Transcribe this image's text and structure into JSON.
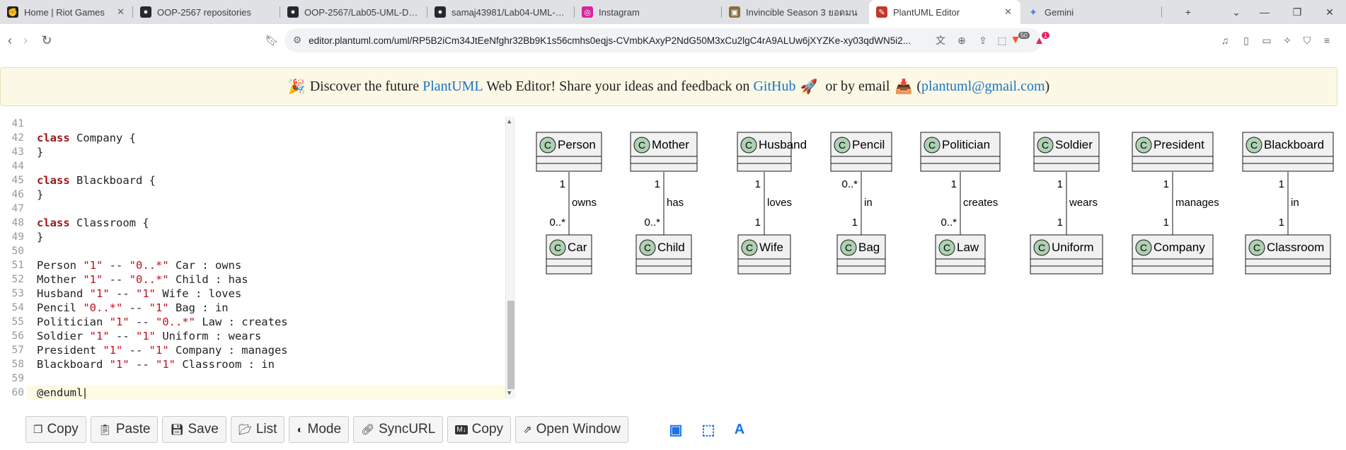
{
  "tabs": [
    {
      "title": "Home | Riot Games",
      "icon": "riot-icon",
      "close": "✕"
    },
    {
      "title": "OOP-2567 repositories",
      "icon": "github-icon"
    },
    {
      "title": "OOP-2567/Lab05-UML-Diagra",
      "icon": "github-icon"
    },
    {
      "title": "samaj43981/Lab04-UML-Diag",
      "icon": "github-icon"
    },
    {
      "title": "Instagram",
      "icon": "instagram-icon"
    },
    {
      "title": "Invincible Season 3 ยอดมน",
      "icon": "image-icon"
    },
    {
      "title": "PlantUML Editor",
      "icon": "plantuml-icon",
      "close": "✕"
    },
    {
      "title": "Gemini",
      "icon": "gemini-icon"
    }
  ],
  "new_tab": "+",
  "address": {
    "url": "editor.plantuml.com/uml/RP5B2iCm34JtEeNfghr32Bb9K1s56cmhs0eqjs-CVmbKAxyP2NdG50M3xCu2lgC4rA9ALUw6jXYZKe-xy03qdWN5i2...",
    "badge_brave": "50",
    "badge_alert": "1"
  },
  "banner": {
    "prefix": "Discover the future ",
    "link1": "PlantUML",
    "mid": " Web Editor! Share your ideas and feedback on ",
    "link2": "GitHub",
    "mid2": " or by email ",
    "open_paren": "(",
    "email": "plantuml@gmail.com",
    "close_paren": ")"
  },
  "editor": {
    "lines": [
      {
        "n": "41",
        "tokens": []
      },
      {
        "n": "42",
        "tokens": [
          {
            "t": "class",
            "c": "kw"
          },
          {
            "t": " Company {",
            "c": ""
          }
        ]
      },
      {
        "n": "43",
        "tokens": [
          {
            "t": "}",
            "c": ""
          }
        ]
      },
      {
        "n": "44",
        "tokens": []
      },
      {
        "n": "45",
        "tokens": [
          {
            "t": "class",
            "c": "kw"
          },
          {
            "t": " Blackboard {",
            "c": ""
          }
        ]
      },
      {
        "n": "46",
        "tokens": [
          {
            "t": "}",
            "c": ""
          }
        ]
      },
      {
        "n": "47",
        "tokens": []
      },
      {
        "n": "48",
        "tokens": [
          {
            "t": "class",
            "c": "kw"
          },
          {
            "t": " Classroom {",
            "c": ""
          }
        ]
      },
      {
        "n": "49",
        "tokens": [
          {
            "t": "}",
            "c": ""
          }
        ]
      },
      {
        "n": "50",
        "tokens": []
      },
      {
        "n": "51",
        "tokens": [
          {
            "t": "Person ",
            "c": ""
          },
          {
            "t": "\"1\"",
            "c": "str"
          },
          {
            "t": " -- ",
            "c": ""
          },
          {
            "t": "\"0..*\"",
            "c": "str"
          },
          {
            "t": " Car : owns",
            "c": ""
          }
        ]
      },
      {
        "n": "52",
        "tokens": [
          {
            "t": "Mother ",
            "c": ""
          },
          {
            "t": "\"1\"",
            "c": "str"
          },
          {
            "t": " -- ",
            "c": ""
          },
          {
            "t": "\"0..*\"",
            "c": "str"
          },
          {
            "t": " Child : has",
            "c": ""
          }
        ]
      },
      {
        "n": "53",
        "tokens": [
          {
            "t": "Husband ",
            "c": ""
          },
          {
            "t": "\"1\"",
            "c": "str"
          },
          {
            "t": " -- ",
            "c": ""
          },
          {
            "t": "\"1\"",
            "c": "str"
          },
          {
            "t": " Wife : loves",
            "c": ""
          }
        ]
      },
      {
        "n": "54",
        "tokens": [
          {
            "t": "Pencil ",
            "c": ""
          },
          {
            "t": "\"0..*\"",
            "c": "str"
          },
          {
            "t": " -- ",
            "c": ""
          },
          {
            "t": "\"1\"",
            "c": "str"
          },
          {
            "t": " Bag : in",
            "c": ""
          }
        ]
      },
      {
        "n": "55",
        "tokens": [
          {
            "t": "Politician ",
            "c": ""
          },
          {
            "t": "\"1\"",
            "c": "str"
          },
          {
            "t": " -- ",
            "c": ""
          },
          {
            "t": "\"0..*\"",
            "c": "str"
          },
          {
            "t": " Law : creates",
            "c": ""
          }
        ]
      },
      {
        "n": "56",
        "tokens": [
          {
            "t": "Soldier ",
            "c": ""
          },
          {
            "t": "\"1\"",
            "c": "str"
          },
          {
            "t": " -- ",
            "c": ""
          },
          {
            "t": "\"1\"",
            "c": "str"
          },
          {
            "t": " Uniform : wears",
            "c": ""
          }
        ]
      },
      {
        "n": "57",
        "tokens": [
          {
            "t": "President ",
            "c": ""
          },
          {
            "t": "\"1\"",
            "c": "str"
          },
          {
            "t": " -- ",
            "c": ""
          },
          {
            "t": "\"1\"",
            "c": "str"
          },
          {
            "t": " Company : manages",
            "c": ""
          }
        ]
      },
      {
        "n": "58",
        "tokens": [
          {
            "t": "Blackboard ",
            "c": ""
          },
          {
            "t": "\"1\"",
            "c": "str"
          },
          {
            "t": " -- ",
            "c": ""
          },
          {
            "t": "\"1\"",
            "c": "str"
          },
          {
            "t": " Classroom : in",
            "c": ""
          }
        ]
      },
      {
        "n": "59",
        "tokens": []
      },
      {
        "n": "60",
        "tokens": [
          {
            "t": "@enduml",
            "c": ""
          }
        ]
      }
    ]
  },
  "diagram": {
    "class_marker": "C",
    "relations": [
      {
        "from": "Person",
        "to": "Car",
        "from_mult": "1",
        "to_mult": "0..*",
        "label": "owns"
      },
      {
        "from": "Mother",
        "to": "Child",
        "from_mult": "1",
        "to_mult": "0..*",
        "label": "has"
      },
      {
        "from": "Husband",
        "to": "Wife",
        "from_mult": "1",
        "to_mult": "1",
        "label": "loves"
      },
      {
        "from": "Pencil",
        "to": "Bag",
        "from_mult": "0..*",
        "to_mult": "1",
        "label": "in"
      },
      {
        "from": "Politician",
        "to": "Law",
        "from_mult": "1",
        "to_mult": "0..*",
        "label": "creates"
      },
      {
        "from": "Soldier",
        "to": "Uniform",
        "from_mult": "1",
        "to_mult": "1",
        "label": "wears"
      },
      {
        "from": "President",
        "to": "Company",
        "from_mult": "1",
        "to_mult": "1",
        "label": "manages"
      },
      {
        "from": "Blackboard",
        "to": "Classroom",
        "from_mult": "1",
        "to_mult": "1",
        "label": "in"
      }
    ]
  },
  "buttons": [
    {
      "label": "Copy",
      "icon": "copy-icon"
    },
    {
      "label": "Paste",
      "icon": "paste-icon"
    },
    {
      "label": "Save",
      "icon": "save-icon"
    },
    {
      "label": "List",
      "icon": "folder-icon"
    },
    {
      "label": "Mode",
      "icon": "contrast-icon"
    },
    {
      "label": "SyncURL",
      "icon": "link-icon"
    },
    {
      "label": "Copy",
      "icon": "markdown-icon"
    },
    {
      "label": "Open Window",
      "icon": "external-link-icon"
    }
  ],
  "colors": {
    "accent": "#1a73e8",
    "class_header": "#f1f1f1",
    "class_circle": "#add1b2",
    "banner_bg": "#fbf8e5",
    "string": "#c0121d",
    "keyword": "#a31515"
  }
}
